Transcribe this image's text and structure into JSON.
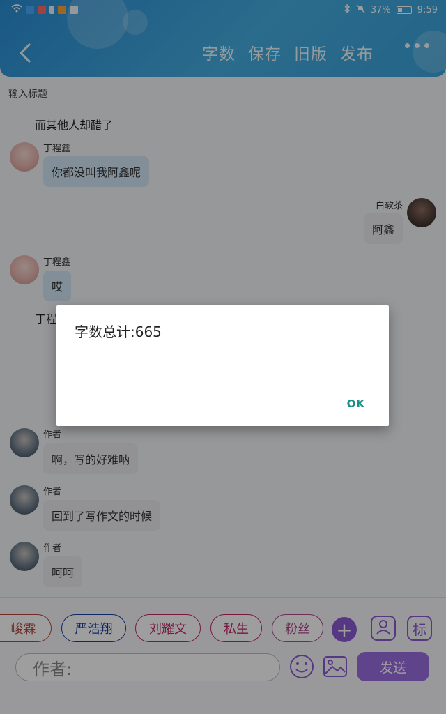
{
  "statusbar": {
    "battery": "37%",
    "time": "9:59"
  },
  "toolbar": {
    "actions": [
      "字数",
      "保存",
      "旧版",
      "发布"
    ]
  },
  "title_placeholder": "输入标题",
  "messages": {
    "narration1": "而其他人却醋了",
    "m1": {
      "name": "丁程鑫",
      "text": "你都没叫我阿鑫呢"
    },
    "m2": {
      "name": "白软茶",
      "text": "阿鑫"
    },
    "m3": {
      "name": "丁程鑫",
      "text": "哎"
    },
    "narration2": "丁程",
    "m4": {
      "name": "作者",
      "text": "啊，写的好难呐"
    },
    "m5": {
      "name": "作者",
      "text": "回到了写作文的时候"
    },
    "m6": {
      "name": "作者",
      "text": "呵呵"
    }
  },
  "chips": [
    "峻霖",
    "严浩翔",
    "刘耀文",
    "私生",
    "粉丝"
  ],
  "chip_colors": [
    "#b04a3b",
    "#1a3fa0",
    "#c2276a",
    "#c2276a",
    "#b04a8c"
  ],
  "square_icons": [
    "person-icon",
    "标"
  ],
  "input": {
    "placeholder": "作者:"
  },
  "send_label": "发送",
  "dialog": {
    "message": "字数总计:665",
    "ok": "OK"
  }
}
